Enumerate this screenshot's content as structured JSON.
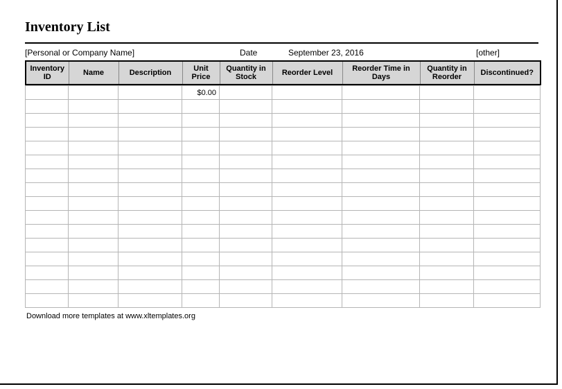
{
  "title": "Inventory List",
  "meta": {
    "company_placeholder": "[Personal or Company Name]",
    "date_label": "Date",
    "date_value": "September 23, 2016",
    "other_placeholder": "[other]"
  },
  "columns": [
    "Inventory ID",
    "Name",
    "Description",
    "Unit Price",
    "Quantity in Stock",
    "Reorder Level",
    "Reorder Time in Days",
    "Quantity in Reorder",
    "Discontinued?"
  ],
  "rows": [
    {
      "inventory_id": "",
      "name": "",
      "description": "",
      "unit_price": "$0.00",
      "qty_stock": "",
      "reorder_level": "",
      "reorder_time": "",
      "qty_reorder": "",
      "discontinued": ""
    },
    {
      "inventory_id": "",
      "name": "",
      "description": "",
      "unit_price": "",
      "qty_stock": "",
      "reorder_level": "",
      "reorder_time": "",
      "qty_reorder": "",
      "discontinued": ""
    },
    {
      "inventory_id": "",
      "name": "",
      "description": "",
      "unit_price": "",
      "qty_stock": "",
      "reorder_level": "",
      "reorder_time": "",
      "qty_reorder": "",
      "discontinued": ""
    },
    {
      "inventory_id": "",
      "name": "",
      "description": "",
      "unit_price": "",
      "qty_stock": "",
      "reorder_level": "",
      "reorder_time": "",
      "qty_reorder": "",
      "discontinued": ""
    },
    {
      "inventory_id": "",
      "name": "",
      "description": "",
      "unit_price": "",
      "qty_stock": "",
      "reorder_level": "",
      "reorder_time": "",
      "qty_reorder": "",
      "discontinued": ""
    },
    {
      "inventory_id": "",
      "name": "",
      "description": "",
      "unit_price": "",
      "qty_stock": "",
      "reorder_level": "",
      "reorder_time": "",
      "qty_reorder": "",
      "discontinued": ""
    },
    {
      "inventory_id": "",
      "name": "",
      "description": "",
      "unit_price": "",
      "qty_stock": "",
      "reorder_level": "",
      "reorder_time": "",
      "qty_reorder": "",
      "discontinued": ""
    },
    {
      "inventory_id": "",
      "name": "",
      "description": "",
      "unit_price": "",
      "qty_stock": "",
      "reorder_level": "",
      "reorder_time": "",
      "qty_reorder": "",
      "discontinued": ""
    },
    {
      "inventory_id": "",
      "name": "",
      "description": "",
      "unit_price": "",
      "qty_stock": "",
      "reorder_level": "",
      "reorder_time": "",
      "qty_reorder": "",
      "discontinued": ""
    },
    {
      "inventory_id": "",
      "name": "",
      "description": "",
      "unit_price": "",
      "qty_stock": "",
      "reorder_level": "",
      "reorder_time": "",
      "qty_reorder": "",
      "discontinued": ""
    },
    {
      "inventory_id": "",
      "name": "",
      "description": "",
      "unit_price": "",
      "qty_stock": "",
      "reorder_level": "",
      "reorder_time": "",
      "qty_reorder": "",
      "discontinued": ""
    },
    {
      "inventory_id": "",
      "name": "",
      "description": "",
      "unit_price": "",
      "qty_stock": "",
      "reorder_level": "",
      "reorder_time": "",
      "qty_reorder": "",
      "discontinued": ""
    },
    {
      "inventory_id": "",
      "name": "",
      "description": "",
      "unit_price": "",
      "qty_stock": "",
      "reorder_level": "",
      "reorder_time": "",
      "qty_reorder": "",
      "discontinued": ""
    },
    {
      "inventory_id": "",
      "name": "",
      "description": "",
      "unit_price": "",
      "qty_stock": "",
      "reorder_level": "",
      "reorder_time": "",
      "qty_reorder": "",
      "discontinued": ""
    },
    {
      "inventory_id": "",
      "name": "",
      "description": "",
      "unit_price": "",
      "qty_stock": "",
      "reorder_level": "",
      "reorder_time": "",
      "qty_reorder": "",
      "discontinued": ""
    },
    {
      "inventory_id": "",
      "name": "",
      "description": "",
      "unit_price": "",
      "qty_stock": "",
      "reorder_level": "",
      "reorder_time": "",
      "qty_reorder": "",
      "discontinued": ""
    }
  ],
  "footer_note": "Download more templates at www.xltemplates.org"
}
